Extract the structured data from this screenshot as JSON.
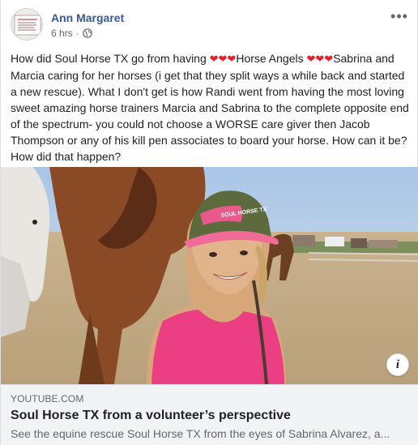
{
  "post": {
    "author": "Ann Margaret",
    "time": "6 hrs",
    "separator": "·",
    "more_label": "•••",
    "text_parts": [
      "How did Soul Horse TX go from having ",
      "❤❤❤",
      "Horse Angels ",
      "❤❤❤",
      "Sabrina and Marcia caring for her horses (i get that they split ways a while back and started a new rescue). What I don't get is how Randi went from having the most loving sweet amazing horse trainers Marcia and Sabrina to the complete opposite end of the spectrum- you could not choose a WORSE care giver then Jacob Thompson or any of his kill pen associates to board your horse. How can it be? How did that happen?"
    ]
  },
  "media": {
    "cap_text": "SOUL HORSE TX",
    "info_label": "i"
  },
  "link": {
    "domain": "YOUTUBE.COM",
    "title": "Soul Horse TX from a volunteer’s perspective",
    "description": "See the equine rescue Soul Horse TX from the eyes of Sabrina Alvarez, a..."
  },
  "colors": {
    "author_link": "#385898",
    "heart": "#e8202a",
    "card_bg": "#f2f3f5"
  },
  "icons": [
    "globe-icon",
    "more-options-icon",
    "info-icon",
    "heart-icon"
  ]
}
